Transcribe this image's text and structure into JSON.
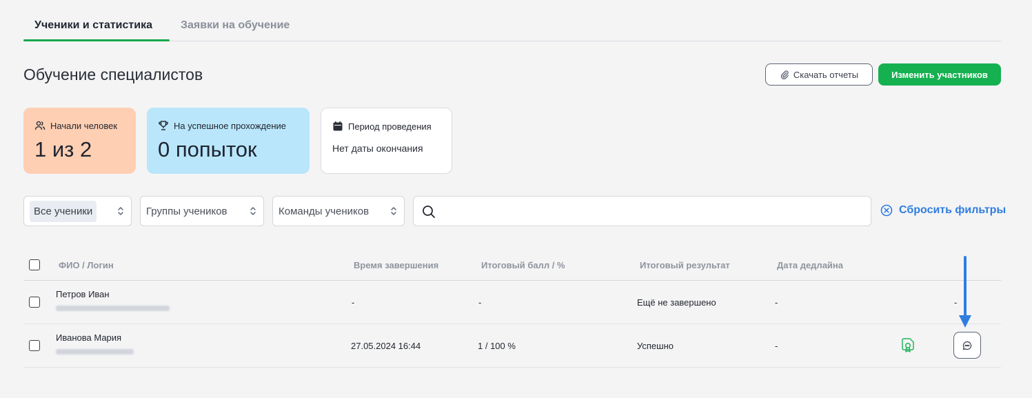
{
  "tabs": [
    {
      "label": "Ученики и статистика"
    },
    {
      "label": "Заявки на обучение"
    }
  ],
  "header": {
    "title": "Обучение специалистов",
    "download_label": "Скачать отчеты",
    "edit_label": "Изменить участников"
  },
  "cards": {
    "started": {
      "label": "Начали человек",
      "value": "1 из 2",
      "icon": "users-icon"
    },
    "success": {
      "label": "На успешное прохождение",
      "value": "0 попыток",
      "icon": "trophy-icon"
    },
    "period": {
      "label": "Период проведения",
      "value": "Нет даты окончания",
      "icon": "calendar-icon"
    }
  },
  "filters": {
    "all_students": "Все ученики",
    "groups": "Группы учеников",
    "teams": "Команды учеников",
    "search_value": "",
    "reset_label": "Сбросить фильтры"
  },
  "table": {
    "columns": [
      "ФИО / Логин",
      "Время завершения",
      "Итоговый балл / %",
      "Итоговый результат",
      "Дата дедлайна"
    ],
    "rows": [
      {
        "name": "Петров Иван",
        "finish": "-",
        "score": "-",
        "result": "Ещё не завершено",
        "deadline": "-",
        "extra": "-"
      },
      {
        "name": "Иванова Мария",
        "finish": "27.05.2024 16:44",
        "score": "1 / 100 %",
        "result": "Успешно",
        "deadline": "-",
        "extra": ""
      }
    ]
  },
  "colors": {
    "accent_green": "#15b050",
    "link_blue": "#2f7de0",
    "card_orange": "#ffcfb3",
    "card_blue": "#b9e6fb"
  }
}
